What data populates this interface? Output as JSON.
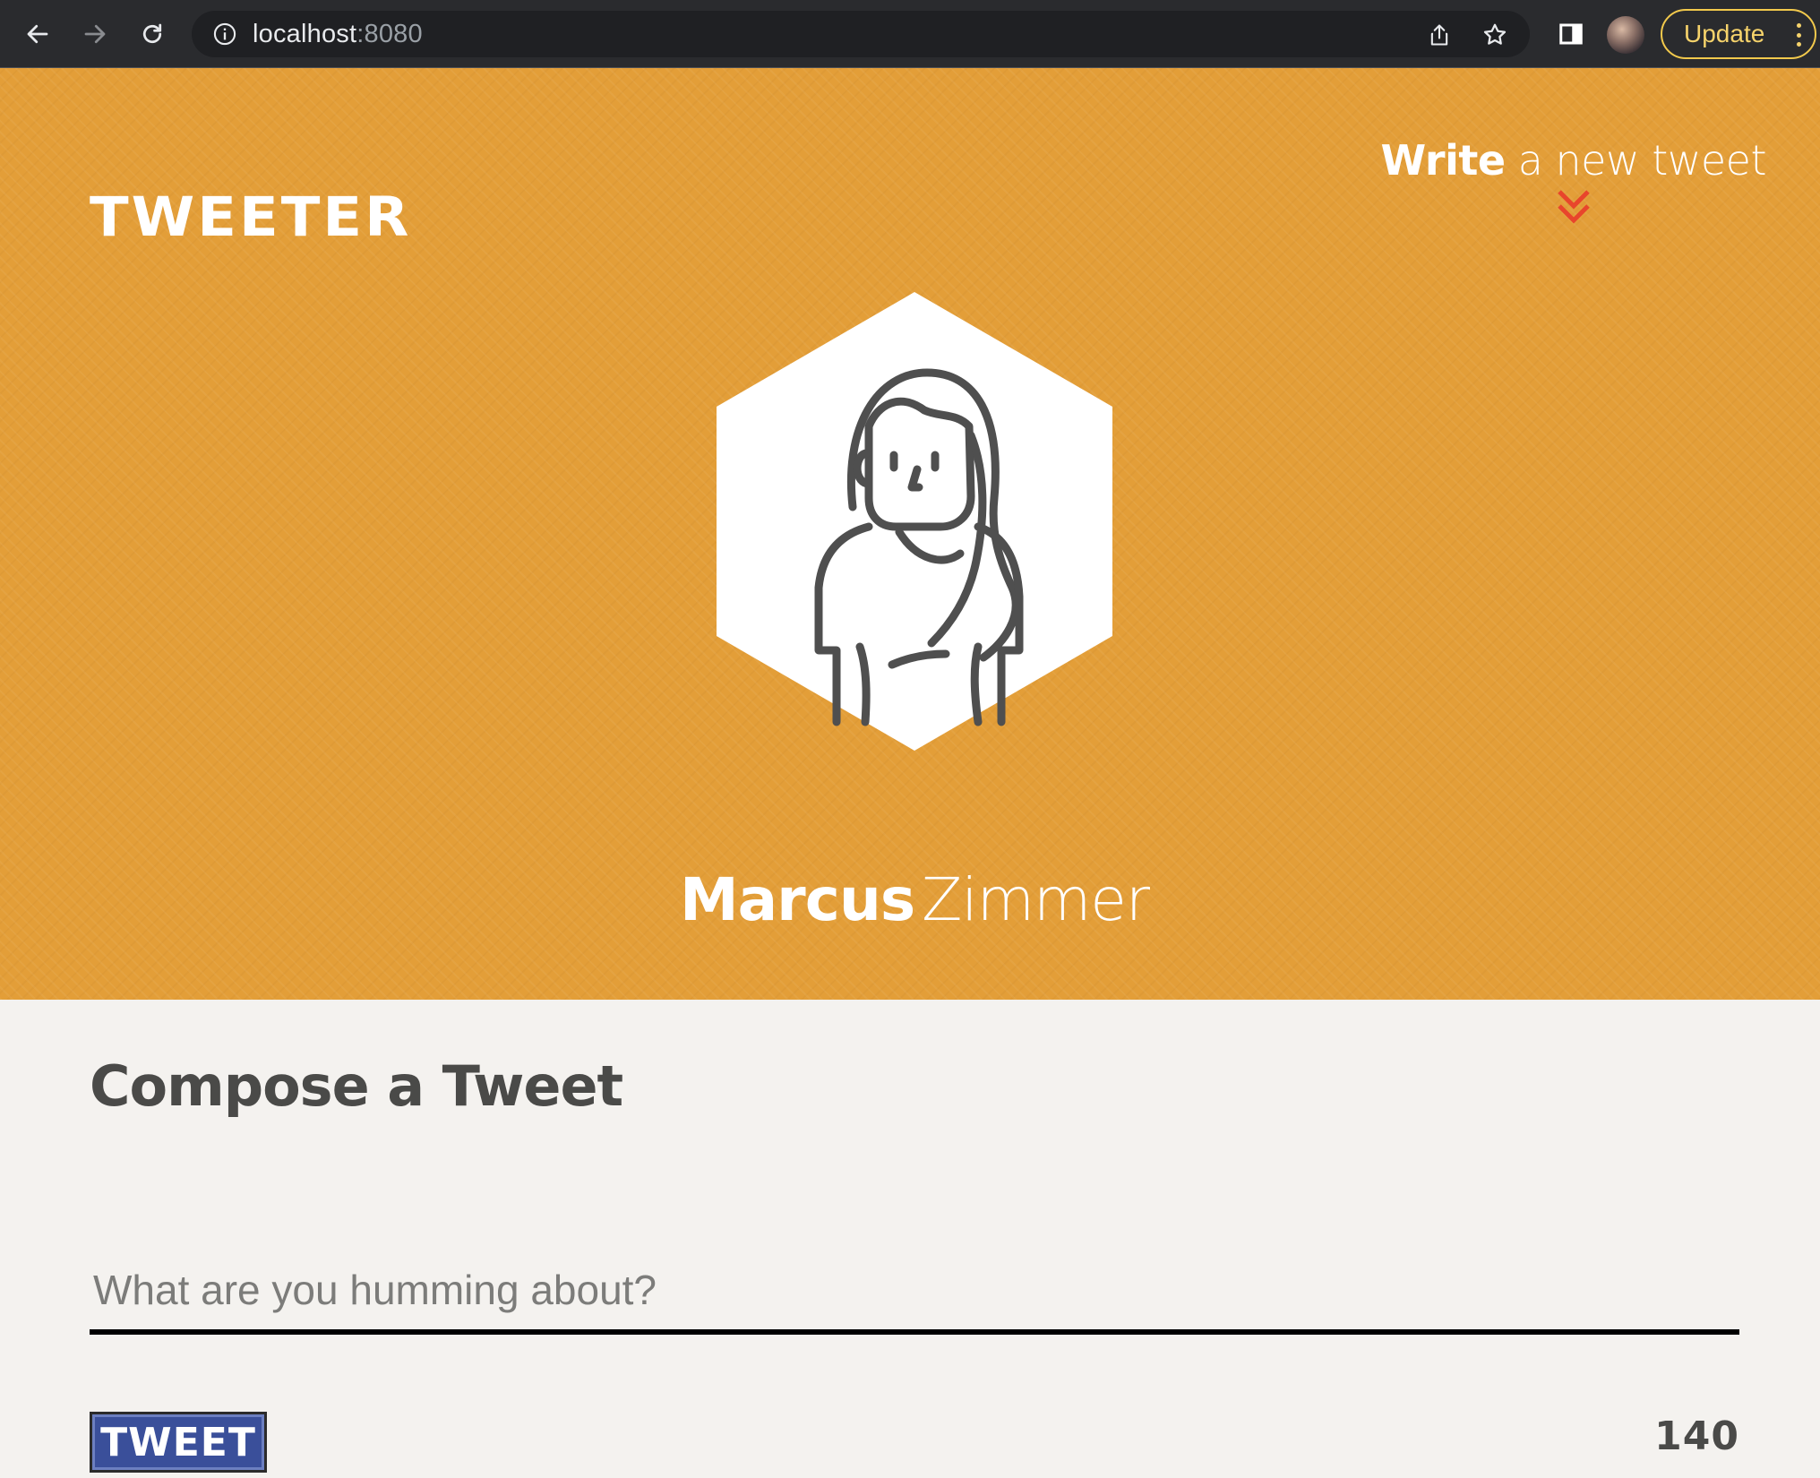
{
  "browser": {
    "url_host": "localhost",
    "url_port": ":8080",
    "update_label": "Update"
  },
  "header": {
    "brand": "TWEETER",
    "compose_toggle": {
      "bold": "Write",
      "rest": "a new tweet"
    },
    "user": {
      "first_name": "Marcus",
      "last_name": "Zimmer",
      "avatar_icon": "person-avatar-icon"
    }
  },
  "compose": {
    "title": "Compose a Tweet",
    "placeholder": "What are you humming about?",
    "value": "",
    "submit_label": "TWEET",
    "char_counter": "140"
  },
  "colors": {
    "hero_bg": "#e39e38",
    "accent_red": "#e8452c",
    "button_blue": "#3a4f9a",
    "page_bg": "#f4f2ef",
    "update_yellow": "#f2c94c"
  }
}
